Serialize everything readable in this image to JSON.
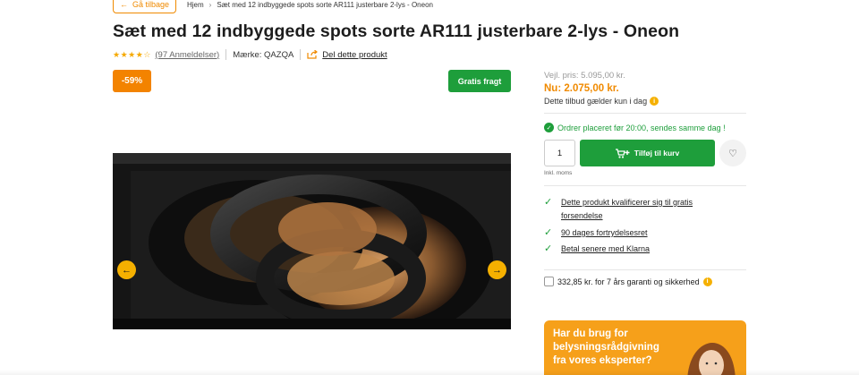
{
  "nav": {
    "back_label": "Gå tilbage",
    "breadcrumb": [
      "Hjem",
      "Sæt med 12 indbyggede spots sorte AR111 justerbare 2-lys - Oneon"
    ]
  },
  "product": {
    "title": "Sæt med 12 indbyggede spots sorte AR111 justerbare 2-lys - Oneon",
    "rating": 4,
    "rating_max": 5,
    "reviews": "(97 Anmeldelser)",
    "brand": "Mærke: QAZQA",
    "share": "Del dette produkt",
    "discount_badge": "-59%",
    "free_shipping_badge": "Gratis fragt"
  },
  "pricing": {
    "rrp": "Vejl. pris: 5.095,00 kr.",
    "price": "Nu: 2.075,00 kr.",
    "offer_note": "Dette tilbud gælder kun i dag",
    "shipping_note": "Ordrer placeret før 20:00, sendes samme dag !",
    "quantity": "1",
    "add_to_cart": "Tilføj til kurv",
    "vat_note": "Inkl. moms"
  },
  "benefits": [
    "Dette produkt kvalificerer sig til gratis forsendelse",
    "90 dages fortrydelsesret",
    "Betal senere med Klarna"
  ],
  "warranty": "332,85 kr. for 7 års garanti og sikkerhed",
  "advice": "Har du brug for belysningsrådgivning fra vores eksperter?",
  "colors": {
    "accent_orange": "#f08a00",
    "green": "#1e9e3b",
    "yellow": "#f5b000"
  }
}
